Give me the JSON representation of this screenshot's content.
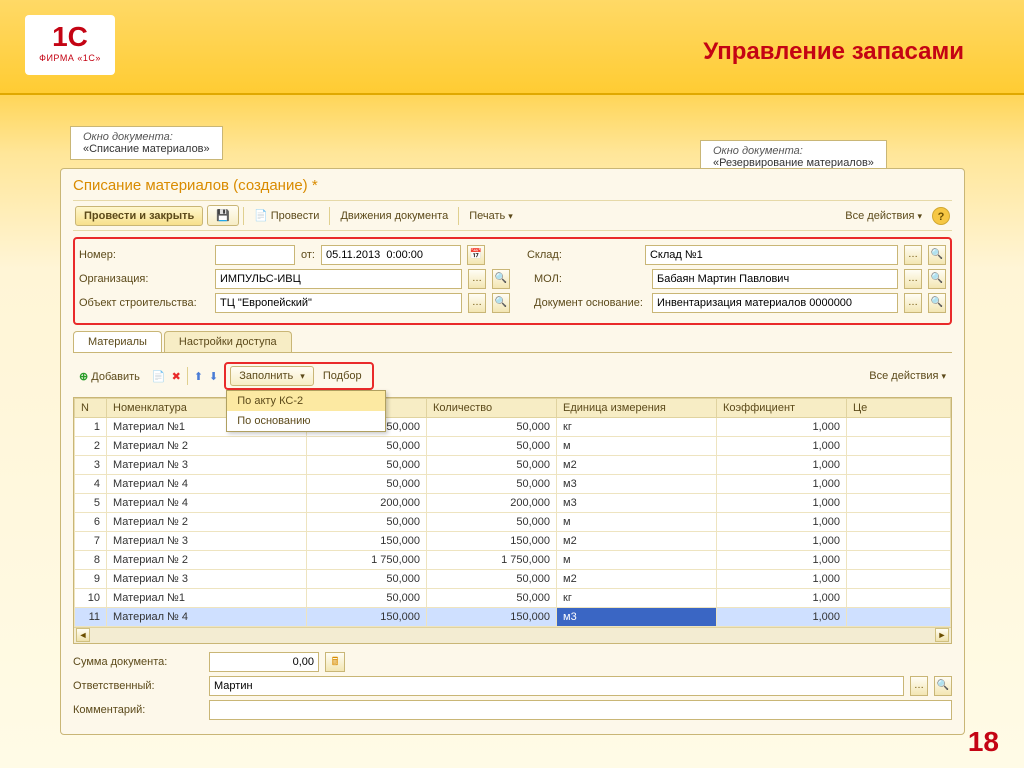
{
  "slide": {
    "logo_main": "1C",
    "logo_sub": "ФИРМА «1С»",
    "title": "Управление запасами",
    "page_number": "18"
  },
  "annotations": {
    "ann1_label": "Окно документа:",
    "ann1_text": "«Списание материалов»",
    "ann2_label": "Окно документа:",
    "ann2_text": "«Резервирование материалов»"
  },
  "window": {
    "title": "Списание материалов (создание) *",
    "toolbar": {
      "post_close": "Провести и закрыть",
      "post": "Провести",
      "movements": "Движения документа",
      "print": "Печать",
      "all_actions": "Все действия"
    },
    "fields": {
      "number_label": "Номер:",
      "number_value": "",
      "from_label": "от:",
      "date_value": "05.11.2013  0:00:00",
      "warehouse_label": "Склад:",
      "warehouse_value": "Склад №1",
      "org_label": "Организация:",
      "org_value": "ИМПУЛЬС-ИВЦ",
      "mol_label": "МОЛ:",
      "mol_value": "Бабаян Мартин Павлович",
      "obj_label": "Объект строительства:",
      "obj_value": "ТЦ \"Европейский\"",
      "basis_label": "Документ основание:",
      "basis_value": "Инвентаризация материалов 0000000"
    },
    "tabs": {
      "t1": "Материалы",
      "t2": "Настройки доступа"
    },
    "sub_toolbar": {
      "add": "Добавить",
      "fill": "Заполнить",
      "pick": "Подбор",
      "menu1": "По акту КС-2",
      "menu2": "По основанию",
      "all_actions": "Все действия"
    },
    "grid": {
      "headers": {
        "n": "N",
        "item": "Номенклатура",
        "qty1": "",
        "qty": "Количество",
        "unit": "Единица измерения",
        "coef": "Коэффициент",
        "price": "Це"
      },
      "rows": [
        {
          "n": "1",
          "item": "Материал №1",
          "q1": "50,000",
          "q2": "50,000",
          "unit": "кг",
          "coef": "1,000"
        },
        {
          "n": "2",
          "item": "Материал № 2",
          "q1": "50,000",
          "q2": "50,000",
          "unit": "м",
          "coef": "1,000"
        },
        {
          "n": "3",
          "item": "Материал № 3",
          "q1": "50,000",
          "q2": "50,000",
          "unit": "м2",
          "coef": "1,000"
        },
        {
          "n": "4",
          "item": "Материал № 4",
          "q1": "50,000",
          "q2": "50,000",
          "unit": "м3",
          "coef": "1,000"
        },
        {
          "n": "5",
          "item": "Материал № 4",
          "q1": "200,000",
          "q2": "200,000",
          "unit": "м3",
          "coef": "1,000"
        },
        {
          "n": "6",
          "item": "Материал № 2",
          "q1": "50,000",
          "q2": "50,000",
          "unit": "м",
          "coef": "1,000"
        },
        {
          "n": "7",
          "item": "Материал № 3",
          "q1": "150,000",
          "q2": "150,000",
          "unit": "м2",
          "coef": "1,000"
        },
        {
          "n": "8",
          "item": "Материал № 2",
          "q1": "1 750,000",
          "q2": "1 750,000",
          "unit": "м",
          "coef": "1,000"
        },
        {
          "n": "9",
          "item": "Материал № 3",
          "q1": "50,000",
          "q2": "50,000",
          "unit": "м2",
          "coef": "1,000"
        },
        {
          "n": "10",
          "item": "Материал №1",
          "q1": "50,000",
          "q2": "50,000",
          "unit": "кг",
          "coef": "1,000"
        },
        {
          "n": "11",
          "item": "Материал № 4",
          "q1": "150,000",
          "q2": "150,000",
          "unit": "м3",
          "coef": "1,000"
        }
      ]
    },
    "footer": {
      "sum_label": "Сумма документа:",
      "sum_value": "0,00",
      "resp_label": "Ответственный:",
      "resp_value": "Мартин",
      "comment_label": "Комментарий:",
      "comment_value": ""
    }
  }
}
